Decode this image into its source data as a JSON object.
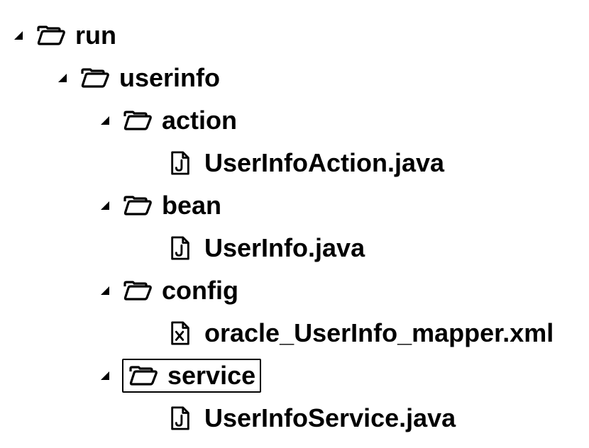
{
  "tree": {
    "run": {
      "label": "run"
    },
    "userinfo": {
      "label": "userinfo"
    },
    "action": {
      "label": "action",
      "file": "UserInfoAction.java"
    },
    "bean": {
      "label": "bean",
      "file": "UserInfo.java"
    },
    "config": {
      "label": "config",
      "file": "oracle_UserInfo_mapper.xml"
    },
    "service": {
      "label": "service",
      "file": "UserInfoService.java"
    }
  }
}
